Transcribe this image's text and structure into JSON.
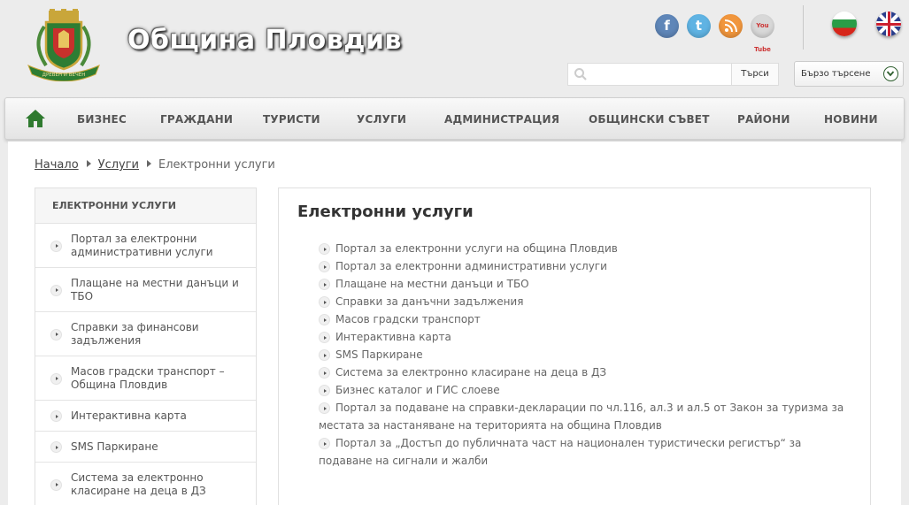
{
  "header": {
    "site_title": "Община Пловдив",
    "logo_motto": "ДРЕВЕН И ВЕЧЕН",
    "social": {
      "facebook_label": "f",
      "twitter_label": "t",
      "youtube_label": "You Tube"
    },
    "search": {
      "placeholder": "",
      "button_label": "Търси"
    },
    "quick_search_label": "Бързо търсене"
  },
  "nav": {
    "items": [
      "БИЗНЕС",
      "ГРАЖДАНИ",
      "ТУРИСТИ",
      "УСЛУГИ",
      "АДМИНИСТРАЦИЯ",
      "ОБЩИНСКИ СЪВЕТ",
      "РАЙОНИ",
      "НОВИНИ"
    ]
  },
  "breadcrumb": {
    "home": "Начало",
    "parent": "Услуги",
    "current": "Електронни услуги"
  },
  "sidebar": {
    "header": "ЕЛЕКТРОННИ УСЛУГИ",
    "items": [
      "Портал за електронни административни услуги",
      "Плащане на местни данъци и ТБО",
      "Справки за финансови задължения",
      "Масов градски транспорт – Община Пловдив",
      "Интерактивна карта",
      "SMS Паркиране",
      "Система за електронно класиране на деца в ДЗ"
    ]
  },
  "content": {
    "title": "Електронни услуги",
    "services": [
      "Портал за електронни услуги на община Пловдив",
      "Портал за електронни административни услуги",
      "Плащане на местни данъци и ТБО",
      "Справки за данъчни задължения",
      "Масов градски транспорт",
      "Интерактивна карта",
      "SMS Паркиране",
      "Система за електронно класиране на деца в ДЗ",
      "Бизнес каталог и ГИС слоеве",
      "Портал за подаване на справки-декларации по чл.116, ал.3 и ал.5 от Закон за туризма за местата за настаняване на територията на община Пловдив",
      "Портал за „Достъп до публичната част  на национален туристически регистър“ за подаване на сигнали и жалби"
    ]
  },
  "colors": {
    "accent_green": "#2f7a2f",
    "page_bg": "#ececec",
    "nav_text": "#555555"
  }
}
